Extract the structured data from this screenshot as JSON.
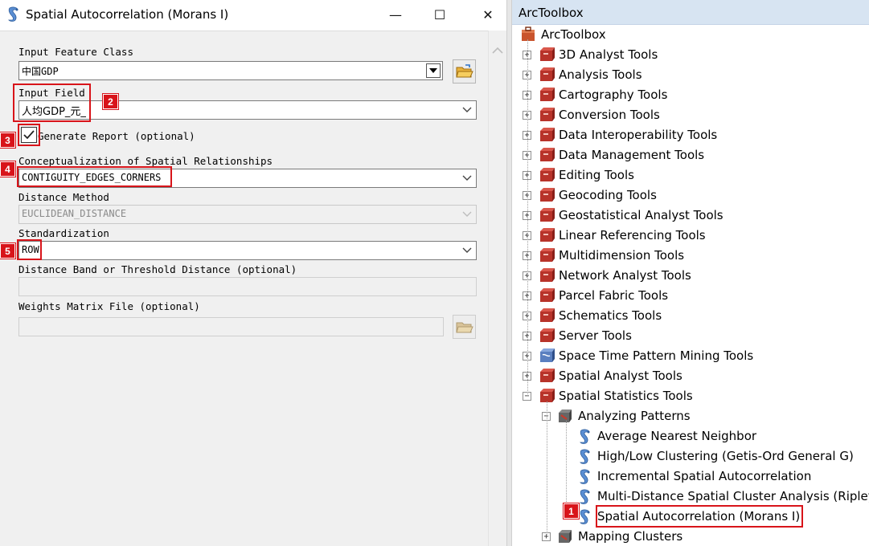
{
  "dialog": {
    "title": "Spatial Autocorrelation (Morans I)",
    "controls": {
      "minimize": "—",
      "maximize": "☐",
      "close": "✕"
    },
    "input_feature_class": {
      "label": "Input Feature Class",
      "value": "中国GDP"
    },
    "input_field": {
      "label": "Input Field",
      "value": "人均GDP_元_"
    },
    "generate_report": {
      "label": "Generate Report (optional)",
      "checked": true
    },
    "conceptualization": {
      "label": "Conceptualization of Spatial Relationships",
      "value": "CONTIGUITY_EDGES_CORNERS"
    },
    "distance_method": {
      "label": "Distance Method",
      "value": "EUCLIDEAN_DISTANCE"
    },
    "standardization": {
      "label": "Standardization",
      "value": "ROW"
    },
    "distance_band": {
      "label": "Distance Band or Threshold Distance (optional)",
      "value": ""
    },
    "weights_matrix": {
      "label": "Weights Matrix File (optional)",
      "value": ""
    }
  },
  "annotations": {
    "b1": "1",
    "b2": "2",
    "b3": "3",
    "b4": "4",
    "b5": "5",
    "color": "#d8141a"
  },
  "toolbox": {
    "header": "ArcToolbox",
    "root": "ArcToolbox",
    "toolsets": [
      "3D Analyst Tools",
      "Analysis Tools",
      "Cartography Tools",
      "Conversion Tools",
      "Data Interoperability Tools",
      "Data Management Tools",
      "Editing Tools",
      "Geocoding Tools",
      "Geostatistical Analyst Tools",
      "Linear Referencing Tools",
      "Multidimension Tools",
      "Network Analyst Tools",
      "Parcel Fabric Tools",
      "Schematics Tools",
      "Server Tools",
      "Space Time Pattern Mining Tools",
      "Spatial Analyst Tools",
      "Spatial Statistics Tools"
    ],
    "subgroups": [
      "Analyzing Patterns",
      "Mapping Clusters"
    ],
    "tools": [
      "Average Nearest Neighbor",
      "High/Low Clustering (Getis-Ord General G)",
      "Incremental Spatial Autocorrelation",
      "Multi-Distance Spatial Cluster Analysis (Ripleys",
      "Spatial Autocorrelation (Morans I)"
    ],
    "expander_collapsed": "+",
    "expander_expanded": "−"
  }
}
